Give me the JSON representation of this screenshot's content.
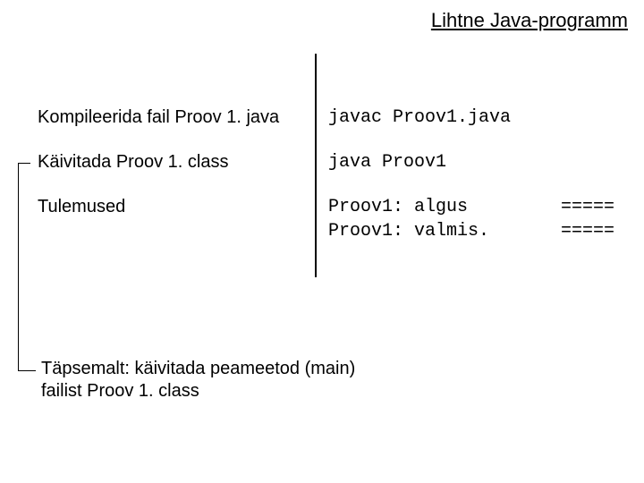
{
  "title": "Lihtne Java-programm",
  "labels": {
    "compile": "Kompileerida fail Proov 1. java",
    "run": "Käivitada  Proov 1. class",
    "results": "Tulemused"
  },
  "commands": {
    "compile": "javac Proov1.java",
    "run": "java Proov1"
  },
  "output": {
    "line1_left": "Proov1: algus",
    "line1_right": "=====",
    "line2_left": "Proov1: valmis.",
    "line2_right": "====="
  },
  "footnote": {
    "line1": "Täpsemalt: käivitada peameetod (main)",
    "line2": "failist Proov 1. class"
  }
}
